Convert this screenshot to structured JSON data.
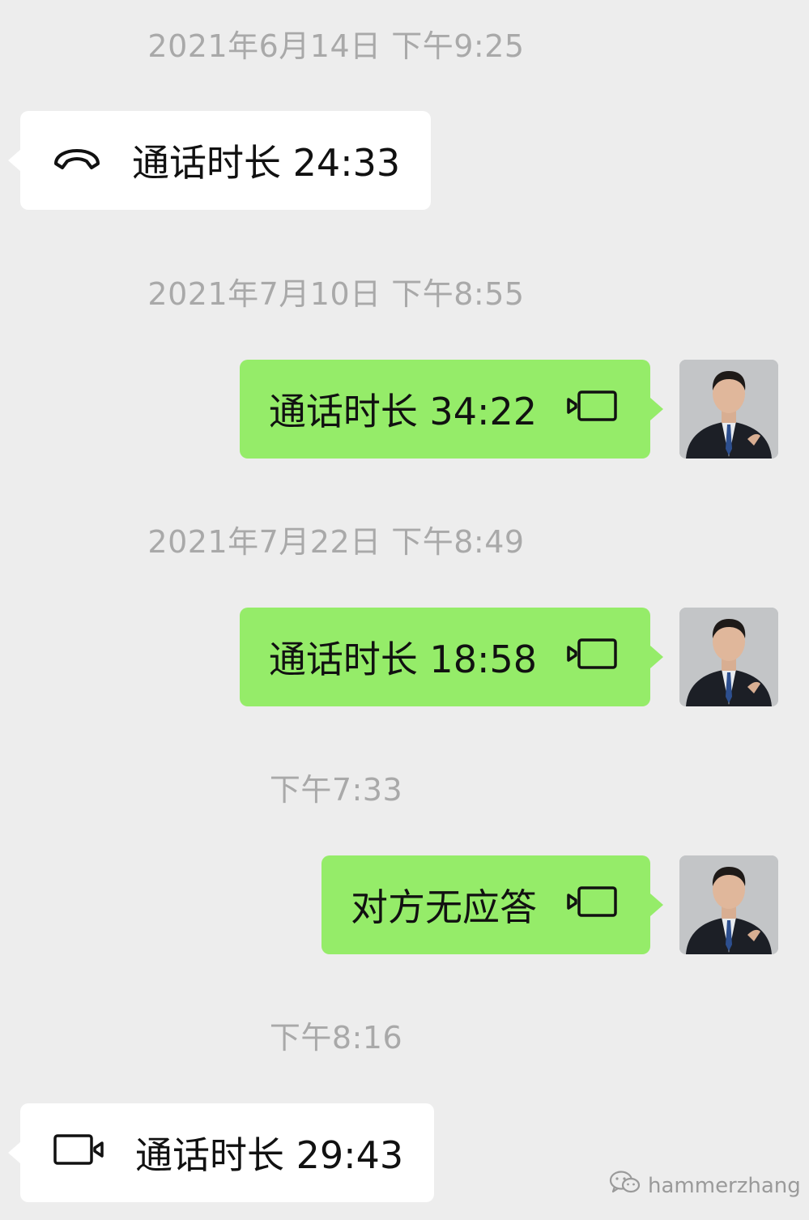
{
  "messages": [
    {
      "type": "timestamp",
      "text": "2021年6月14日 下午9:25"
    },
    {
      "type": "call",
      "direction": "incoming",
      "call_icon": "phone-hangup-icon",
      "text": "通话时长 24:33"
    },
    {
      "type": "timestamp",
      "text": "2021年7月10日 下午8:55"
    },
    {
      "type": "call",
      "direction": "outgoing",
      "call_icon": "video-call-icon",
      "text": "通话时长 34:22"
    },
    {
      "type": "timestamp",
      "text": "2021年7月22日 下午8:49"
    },
    {
      "type": "call",
      "direction": "outgoing",
      "call_icon": "video-call-icon",
      "text": "通话时长 18:58"
    },
    {
      "type": "timestamp",
      "text": "下午7:33"
    },
    {
      "type": "call",
      "direction": "outgoing",
      "call_icon": "video-call-icon",
      "text": "对方无应答"
    },
    {
      "type": "timestamp",
      "text": "下午8:16"
    },
    {
      "type": "call",
      "direction": "incoming",
      "call_icon": "video-call-icon",
      "text": "通话时长 29:43"
    }
  ],
  "watermark": {
    "icon": "wechat-icon",
    "text": "hammerzhang"
  },
  "colors": {
    "background": "#ededed",
    "incoming_bubble": "#ffffff",
    "outgoing_bubble": "#95ec69",
    "timestamp_text": "#a9a9a9"
  }
}
